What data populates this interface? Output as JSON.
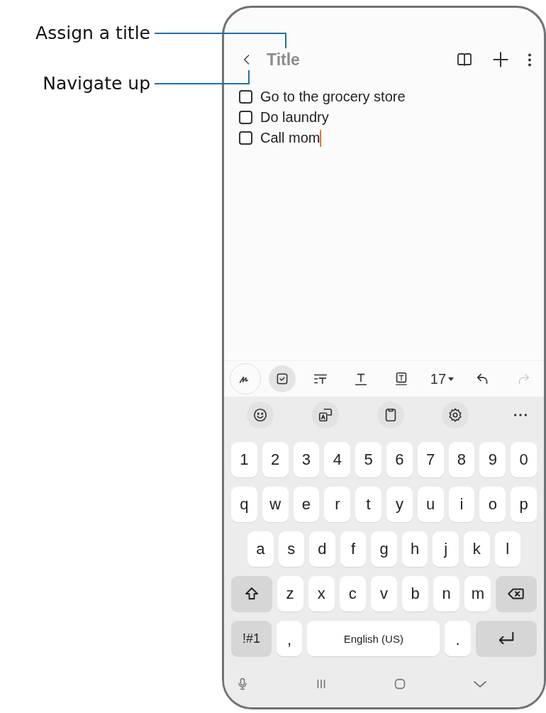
{
  "callouts": [
    {
      "text": "Assign a title"
    },
    {
      "text": "Navigate up"
    }
  ],
  "app_bar": {
    "title": "Title"
  },
  "checklist": [
    {
      "text": "Go to the grocery store",
      "checked": false,
      "cursor": false
    },
    {
      "text": "Do laundry",
      "checked": false,
      "cursor": false
    },
    {
      "text": "Call mom",
      "checked": false,
      "cursor": true
    }
  ],
  "toolbar": [
    {
      "kind": "handwriting",
      "selected": false,
      "disabled": false
    },
    {
      "kind": "checklist",
      "selected": true,
      "disabled": false
    },
    {
      "kind": "text-style",
      "selected": false,
      "disabled": false
    },
    {
      "kind": "underline",
      "selected": false,
      "disabled": false
    },
    {
      "kind": "text-box",
      "selected": false,
      "disabled": false
    },
    {
      "kind": "font-size",
      "label": "17",
      "selected": false,
      "disabled": false
    },
    {
      "kind": "undo",
      "selected": false,
      "disabled": false
    },
    {
      "kind": "redo",
      "selected": false,
      "disabled": true
    }
  ],
  "keyboard": {
    "rows": [
      {
        "keys": [
          {
            "kind": "char",
            "label": "1"
          },
          {
            "kind": "char",
            "label": "2"
          },
          {
            "kind": "char",
            "label": "3"
          },
          {
            "kind": "char",
            "label": "4"
          },
          {
            "kind": "char",
            "label": "5"
          },
          {
            "kind": "char",
            "label": "6"
          },
          {
            "kind": "char",
            "label": "7"
          },
          {
            "kind": "char",
            "label": "8"
          },
          {
            "kind": "char",
            "label": "9"
          },
          {
            "kind": "char",
            "label": "0"
          }
        ]
      },
      {
        "keys": [
          {
            "kind": "char",
            "label": "q"
          },
          {
            "kind": "char",
            "label": "w"
          },
          {
            "kind": "char",
            "label": "e"
          },
          {
            "kind": "char",
            "label": "r"
          },
          {
            "kind": "char",
            "label": "t"
          },
          {
            "kind": "char",
            "label": "y"
          },
          {
            "kind": "char",
            "label": "u"
          },
          {
            "kind": "char",
            "label": "i"
          },
          {
            "kind": "char",
            "label": "o"
          },
          {
            "kind": "char",
            "label": "p"
          }
        ]
      },
      {
        "keys": [
          {
            "kind": "char",
            "label": "a"
          },
          {
            "kind": "char",
            "label": "s"
          },
          {
            "kind": "char",
            "label": "d"
          },
          {
            "kind": "char",
            "label": "f"
          },
          {
            "kind": "char",
            "label": "g"
          },
          {
            "kind": "char",
            "label": "h"
          },
          {
            "kind": "char",
            "label": "j"
          },
          {
            "kind": "char",
            "label": "k"
          },
          {
            "kind": "char",
            "label": "l"
          }
        ]
      },
      {
        "keys": [
          {
            "kind": "shift"
          },
          {
            "kind": "char",
            "label": "z"
          },
          {
            "kind": "char",
            "label": "x"
          },
          {
            "kind": "char",
            "label": "c"
          },
          {
            "kind": "char",
            "label": "v"
          },
          {
            "kind": "char",
            "label": "b"
          },
          {
            "kind": "char",
            "label": "n"
          },
          {
            "kind": "char",
            "label": "m"
          },
          {
            "kind": "backspace"
          }
        ]
      },
      {
        "keys": [
          {
            "kind": "symbols",
            "label": "!#1"
          },
          {
            "kind": "punct",
            "label": ","
          },
          {
            "kind": "space",
            "label": "English (US)"
          },
          {
            "kind": "punct",
            "label": "."
          },
          {
            "kind": "enter"
          }
        ]
      }
    ]
  }
}
